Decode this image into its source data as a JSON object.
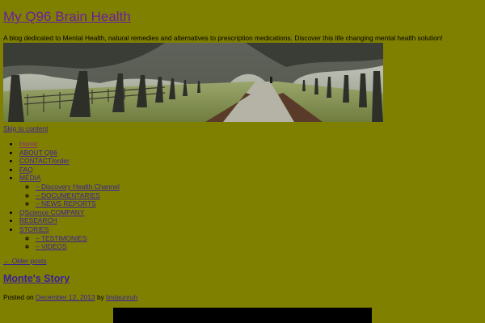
{
  "site": {
    "title": "My Q96 Brain Health",
    "tagline": "A blog dedicated to Mental Health, natural remedies and alternatives to prescription medications. Discover this life changing mental health solution!"
  },
  "skip_link": "Skip to content",
  "menu": {
    "items": [
      {
        "label": "Home"
      },
      {
        "label": "ABOUT Q96"
      },
      {
        "label": "CONTACT/order"
      },
      {
        "label": "FAQ"
      },
      {
        "label": "MEDIA",
        "children": [
          {
            "label": "– Discovery Health Channel"
          },
          {
            "label": "– DOCUMENTARIES"
          },
          {
            "label": "– NEWS REPORTS"
          }
        ]
      },
      {
        "label": "QScience COMPANY"
      },
      {
        "label": "RESEARCH"
      },
      {
        "label": "STORIES",
        "children": [
          {
            "label": "– TESTIMONIES"
          },
          {
            "label": "– VIDEOS"
          }
        ]
      }
    ]
  },
  "nav": {
    "older_posts": "← Older posts"
  },
  "post": {
    "title": "Monte's Story",
    "posted_on_label": "Posted on",
    "date": "December 12, 2013",
    "by_label": "by",
    "author": "lindaunruh"
  },
  "colors": {
    "background": "#808000",
    "link": "#3a1f9c",
    "title_link": "#6a1fa0"
  }
}
